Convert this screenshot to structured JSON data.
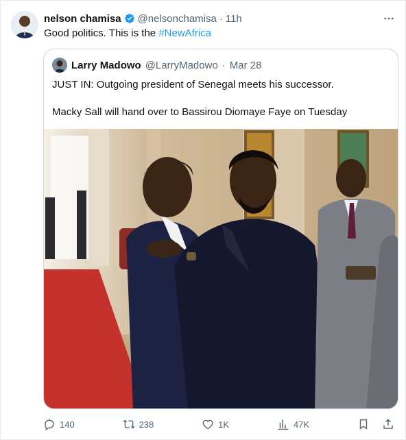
{
  "tweet": {
    "author_name": "nelson chamisa",
    "handle": "@nelsonchamisa",
    "separator": "·",
    "time": "11h",
    "text_plain": "Good politics. This is the ",
    "hashtag": "#NewAfrica",
    "more_label": "⋯"
  },
  "quote": {
    "author_name": "Larry Madowo",
    "handle": "@LarryMadowo",
    "separator": "·",
    "date": "Mar 28",
    "line1": "JUST IN: Outgoing president of Senegal meets his successor.",
    "line2": "Macky Sall will hand over to Bassirou Diomaye Faye on Tuesday"
  },
  "actions": {
    "replies": "140",
    "retweets": "238",
    "likes": "1K",
    "views": "47K"
  },
  "colors": {
    "accent": "#1d9bf0",
    "text_primary": "#0f1419",
    "text_secondary": "#536471",
    "border": "#cfd9de"
  },
  "icons": {
    "verified": "verified-badge-icon",
    "more": "more-icon",
    "reply": "reply-icon",
    "retweet": "retweet-icon",
    "like": "heart-icon",
    "views": "views-icon",
    "bookmark": "bookmark-icon",
    "share": "share-icon"
  }
}
